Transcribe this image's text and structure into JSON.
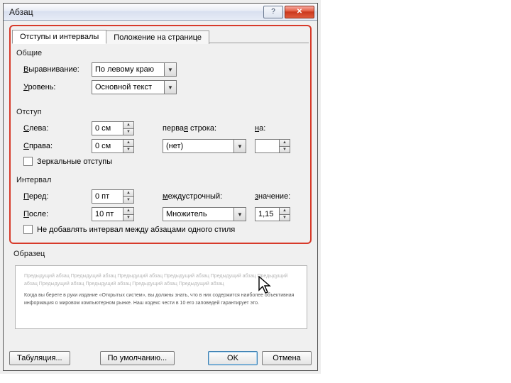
{
  "title": "Абзац",
  "tabs": {
    "active": "Отступы и интервалы",
    "other": "Положение на странице"
  },
  "general": {
    "title": "Общие",
    "align_label_u": "В",
    "align_label_rest": "ыравнивание:",
    "align_value": "По левому краю",
    "level_label_u": "У",
    "level_label_rest": "ровень:",
    "level_value": "Основной текст"
  },
  "indent": {
    "title": "Отступ",
    "left_label": "С",
    "left_label_rest": "лева:",
    "left_value": "0 см",
    "right_label": "С",
    "right_label_rest": "права:",
    "right_value": "0 см",
    "first_label": "перва",
    "first_u": "я",
    "first_rest": " строка:",
    "first_value": "(нет)",
    "by_u": "н",
    "by_rest": "а:",
    "mirror": "Зеркальные отступы"
  },
  "spacing": {
    "title": "Интервал",
    "before_label": "П",
    "before_rest": "еред:",
    "before_value": "0 пт",
    "after_label": "П",
    "after_rest": "осле:",
    "after_value": "10 пт",
    "line_u": "м",
    "line_rest": "еждустрочный:",
    "line_value": "Множитель",
    "at_u": "з",
    "at_rest": "начение:",
    "at_value": "1,15",
    "nosame": "Не добавлять интервал между абзацами одного стиля"
  },
  "preview_label": "Образец",
  "preview_grey": "Предыдущий абзац Предыдущий абзац Предыдущий абзац Предыдущий абзац Предыдущий абзац Предыдущий абзац Предыдущий абзац Предыдущий абзац Предыдущий абзац Предыдущий абзац",
  "preview_dark": "Когда вы берете в руки издание «Открытых систем», вы должны знать, что в них содержится наиболее объективная информация о мировом компьютерном рынке. Наш кодекс чести в 10 его заповедей гарантирует это.",
  "buttons": {
    "tabs": "Табуляция...",
    "default": "По умолчанию...",
    "ok": "OK",
    "cancel": "Отмена"
  }
}
